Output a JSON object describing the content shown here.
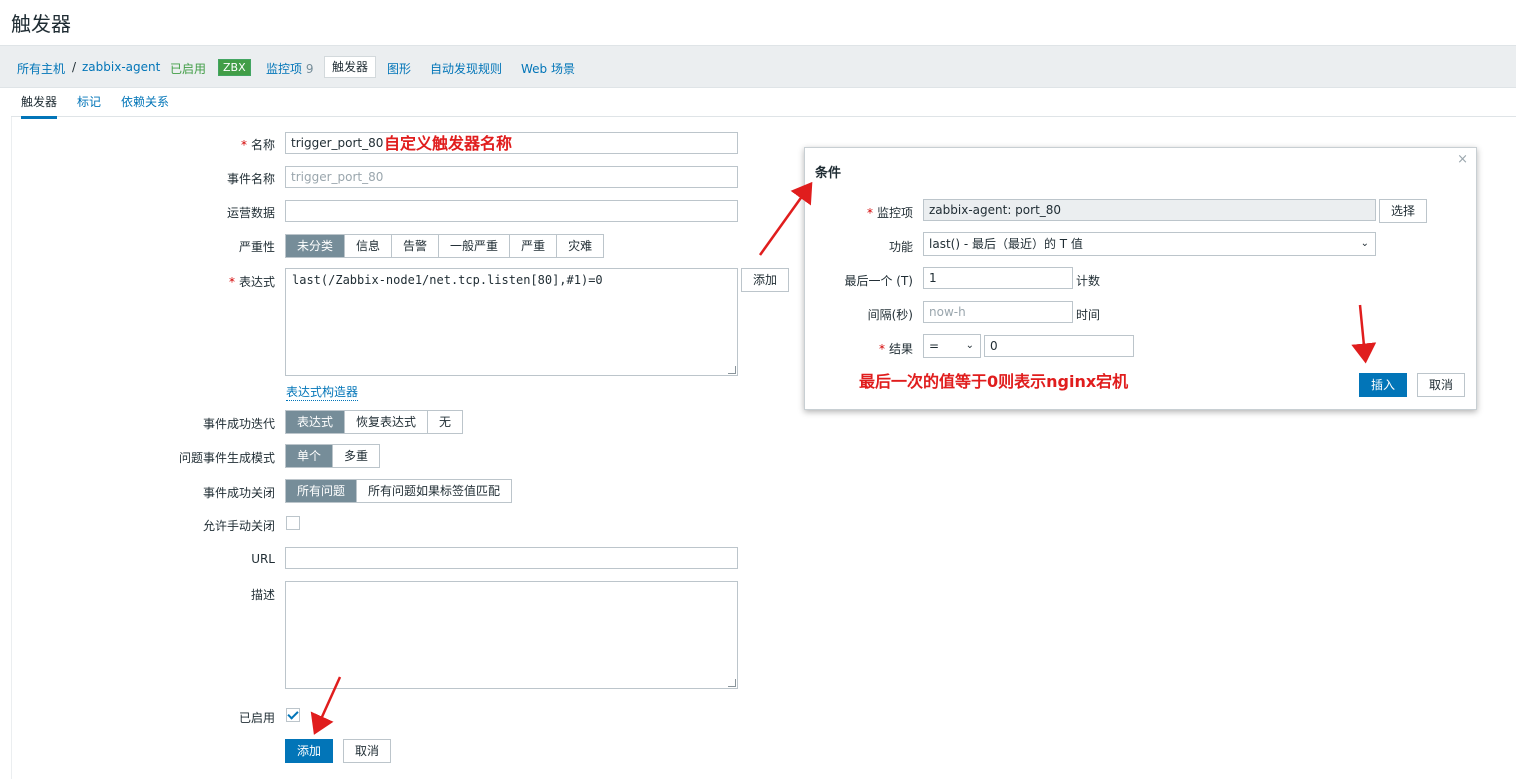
{
  "page": {
    "title": "触发器"
  },
  "nav": {
    "all_hosts": "所有主机",
    "separator": "/",
    "host": "zabbix-agent",
    "status": "已启用",
    "zbx": "ZBX",
    "items": "监控项",
    "items_count": "9",
    "triggers": "触发器",
    "graphs": "图形",
    "discovery": "自动发现规则",
    "web": "Web 场景"
  },
  "tabs": [
    "触发器",
    "标记",
    "依赖关系"
  ],
  "form": {
    "name_label": "名称",
    "name_value": "trigger_port_80",
    "event_name_label": "事件名称",
    "event_name_placeholder": "trigger_port_80",
    "opdata_label": "运营数据",
    "severity_label": "严重性",
    "severity_options": [
      "未分类",
      "信息",
      "告警",
      "一般严重",
      "严重",
      "灾难"
    ],
    "expression_label": "表达式",
    "expression_value": "last(/Zabbix-node1/net.tcp.listen[80],#1)=0",
    "add_label": "添加",
    "expression_builder": "表达式构造器",
    "ok_event_label": "事件成功迭代",
    "ok_event_options": [
      "表达式",
      "恢复表达式",
      "无"
    ],
    "problem_mode_label": "问题事件生成模式",
    "problem_mode_options": [
      "单个",
      "多重"
    ],
    "ok_close_label": "事件成功关闭",
    "ok_close_options": [
      "所有问题",
      "所有问题如果标签值匹配"
    ],
    "manual_close_label": "允许手动关闭",
    "url_label": "URL",
    "description_label": "描述",
    "enabled_label": "已启用",
    "submit_label": "添加",
    "cancel_label": "取消"
  },
  "dialog": {
    "title": "条件",
    "close": "×",
    "item_label": "监控项",
    "item_value": "zabbix-agent: port_80",
    "select_label": "选择",
    "function_label": "功能",
    "function_value": "last() - 最后（最近）的 T 值",
    "last_label": "最后一个 (T)",
    "last_value": "1",
    "last_unit": "计数",
    "interval_label": "间隔(秒)",
    "interval_placeholder": "now-h",
    "interval_unit": "时间",
    "result_label": "结果",
    "result_operator": "=",
    "result_value": "0",
    "insert_label": "插入",
    "cancel_label": "取消"
  },
  "annotations": {
    "name_note": "自定义触发器名称",
    "result_note": "最后一次的值等于0则表示nginx宕机"
  },
  "colors": {
    "annotation": "#e01d1d",
    "link": "#0275b8",
    "selected_segment": "#768d99",
    "enabled": "#429e47"
  }
}
